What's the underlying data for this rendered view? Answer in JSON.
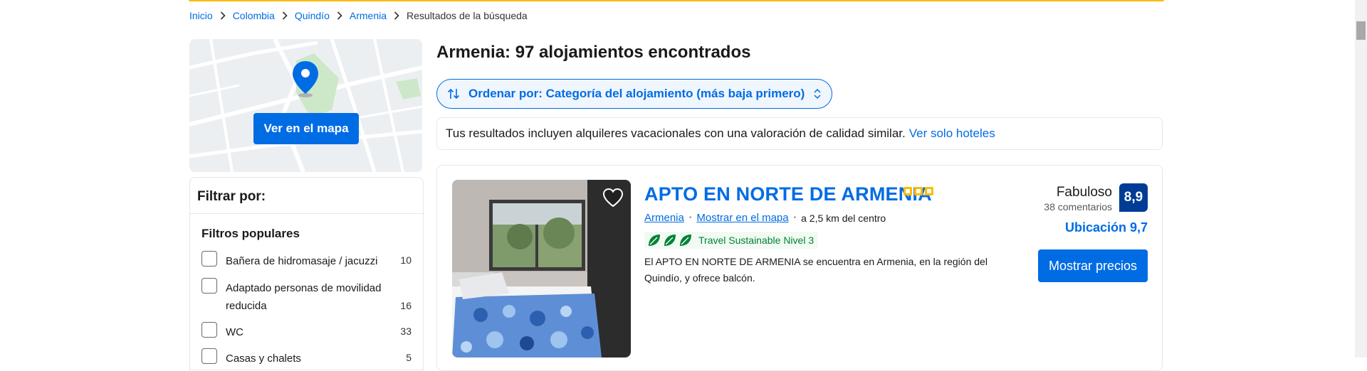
{
  "breadcrumb": [
    {
      "label": "Inicio"
    },
    {
      "label": "Colombia"
    },
    {
      "label": "Quindío"
    },
    {
      "label": "Armenia"
    },
    {
      "label": "Resultados de la búsqueda"
    }
  ],
  "map": {
    "button_label": "Ver en el mapa"
  },
  "filters": {
    "title": "Filtrar por:",
    "section_title": "Filtros populares",
    "items": [
      {
        "label": "Bañera de hidromasaje / jacuzzi",
        "count": "10"
      },
      {
        "label": "Adaptado personas de movilidad reducida",
        "count": "16"
      },
      {
        "label": "WC",
        "count": "33"
      },
      {
        "label": "Casas y chalets",
        "count": "5"
      }
    ]
  },
  "results": {
    "title": "Armenia: 97 alojamientos encontrados",
    "sort_label": "Ordenar por: Categoría del alojamiento (más baja primero)",
    "notice_text": "Tus resultados incluyen alquileres vacacionales con una valoración de calidad similar.",
    "notice_link": "Ver solo hoteles"
  },
  "property": {
    "name": "APTO EN NORTE DE ARMENIA",
    "stars": 3,
    "city_link": "Armenia",
    "map_link": "Mostrar en el mapa",
    "distance": "a 2,5 km del centro",
    "sustainable": "Travel Sustainable Nivel 3",
    "description": "El APTO EN NORTE DE ARMENIA se encuentra en Armenia, en la región del Quindío, y ofrece balcón.",
    "review_word": "Fabuloso",
    "review_count": "38 comentarios",
    "score": "8,9",
    "location_score": "Ubicación 9,7",
    "price_button": "Mostrar precios"
  },
  "colors": {
    "brand_blue": "#006ce4",
    "dark_blue": "#003b95",
    "yellow": "#febb02",
    "green": "#008234"
  }
}
